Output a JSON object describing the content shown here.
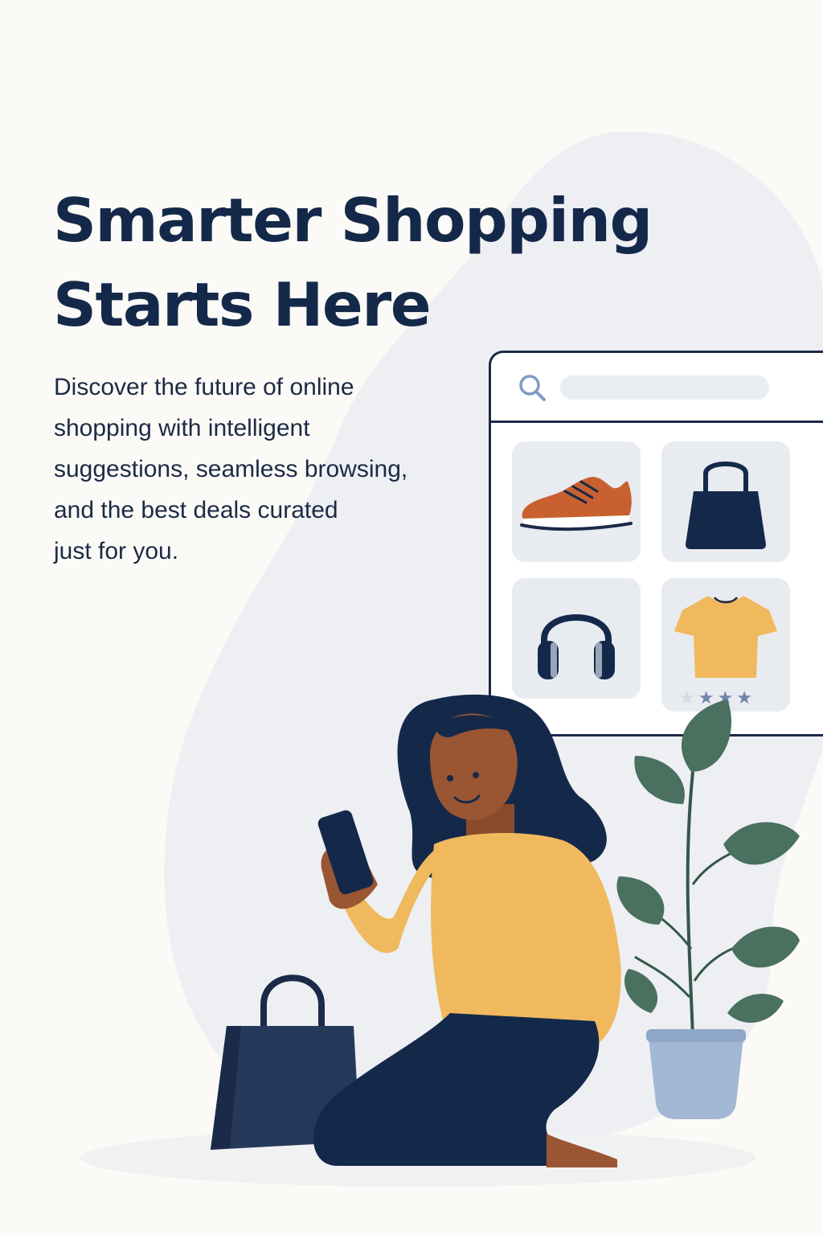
{
  "hero": {
    "headline_line1": "Smarter Shopping",
    "headline_line2": "Starts Here",
    "intro_lines": [
      "Discover the future of online",
      "shopping with intelligent",
      "suggestions, seamless browsing,",
      "and the best deals curated",
      "just for you."
    ]
  },
  "browser": {
    "products": [
      "sneaker",
      "handbag",
      "headphones",
      "t-shirt"
    ],
    "rating_stars": 3,
    "rating_max": 4
  },
  "colors": {
    "background": "#fbfaf6",
    "blob": "#edeff3",
    "navy": "#14294a",
    "accent_orange": "#c8602f",
    "accent_yellow": "#f0b95e",
    "plant_green": "#4a7060",
    "pot_blue": "#a3b8d4"
  },
  "icons": [
    "search-icon",
    "sneaker-icon",
    "handbag-icon",
    "headphones-icon",
    "tshirt-icon",
    "star-icon"
  ]
}
